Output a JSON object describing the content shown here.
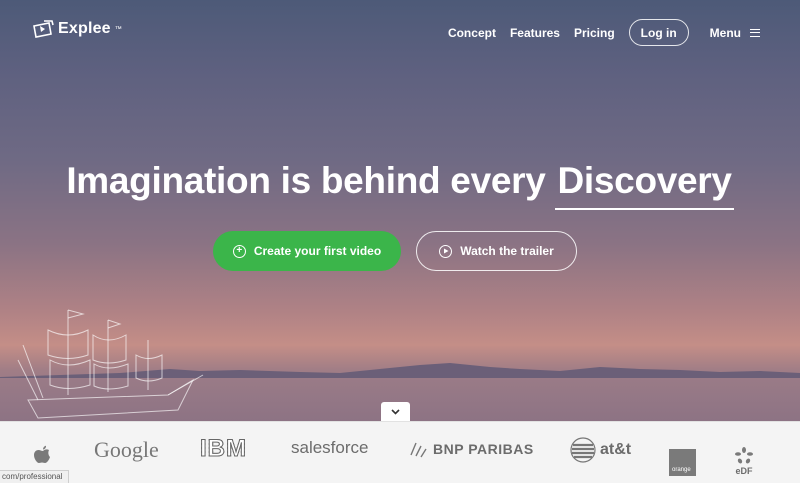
{
  "header": {
    "logo_text": "Explee",
    "logo_mark": "™",
    "nav": {
      "concept": "Concept",
      "features": "Features",
      "pricing": "Pricing",
      "login": "Log in",
      "menu": "Menu"
    }
  },
  "hero": {
    "headline": "Imagination is behind every",
    "headline_strong": "Discovery",
    "primary_button": "Create your first video",
    "secondary_button": "Watch the trailer"
  },
  "brands": {
    "google": "Google",
    "ibm": "IBM",
    "salesforce": "salesforce",
    "bnp": "BNP PARIBAS",
    "att": "at&t",
    "orange": "orange",
    "edf": "eDF"
  },
  "status_bar": {
    "url": "com/professional"
  },
  "colors": {
    "primary_green": "#3bb54a",
    "white": "#ffffff",
    "brand_gray": "#6c6c6c"
  },
  "icons": {
    "logo": "video-card-icon",
    "menu": "hamburger-icon",
    "create": "plus-circle-icon",
    "trailer": "play-circle-icon",
    "scroll": "chevron-down-icon"
  }
}
